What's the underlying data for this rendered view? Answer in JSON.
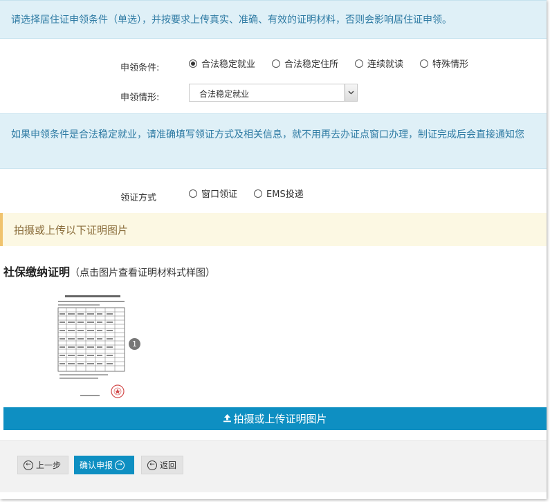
{
  "notice_top": "请选择居住证申领条件（单选），并按要求上传真实、准确、有效的证明材料，否则会影响居住证申领。",
  "condition": {
    "label": "申领条件:",
    "options": [
      "合法稳定就业",
      "合法稳定住所",
      "连续就读",
      "特殊情形"
    ],
    "selected_index": 0
  },
  "situation": {
    "label": "申领情形:",
    "selected": "合法稳定就业"
  },
  "notice_middle": "如果申领条件是合法稳定就业，请准确填写领证方式及相关信息，就不用再去办证点窗口办理，制证完成后会直接通知您",
  "pickup": {
    "label": "领证方式",
    "options": [
      "窗口领证",
      "EMS投递"
    ],
    "selected_index": -1
  },
  "notice_upload": "拍摄或上传以下证明图片",
  "document": {
    "title": "社保缴纳证明",
    "hint": "（点击图片查看证明材料式样图）",
    "count": "1"
  },
  "upload_button": "拍摄或上传证明图片",
  "footer": {
    "prev": "上一步",
    "confirm": "确认申报",
    "back": "返回"
  },
  "colors": {
    "primary": "#0e8fc2",
    "info_bg": "#dff0f7",
    "info_text": "#2d7aa3",
    "warn_bg": "#fcf8e3",
    "warn_text": "#8a6d3b"
  },
  "icons": [
    "upload-icon",
    "arrow-left-circle-icon",
    "arrow-right-circle-icon",
    "chevron-down-icon"
  ]
}
